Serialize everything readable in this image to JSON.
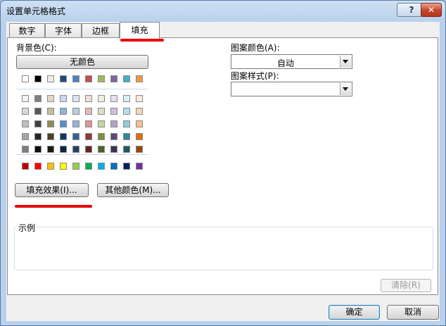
{
  "window": {
    "title": "设置单元格格式",
    "help": "?",
    "close": "✕"
  },
  "tabs": [
    {
      "label": "数字",
      "active": false
    },
    {
      "label": "字体",
      "active": false
    },
    {
      "label": "边框",
      "active": false
    },
    {
      "label": "填充",
      "active": true
    }
  ],
  "fill": {
    "background_label": "背景色(C):",
    "no_color": "无颜色",
    "theme_row": [
      "#ffffff",
      "#000000",
      "#eeece1",
      "#1f497d",
      "#4f81bd",
      "#c0504d",
      "#9bbb59",
      "#8064a2",
      "#4bacc6",
      "#f79646"
    ],
    "shade_rows": [
      [
        "#f2f2f2",
        "#7f7f7f",
        "#ddd9c3",
        "#c6d9f0",
        "#dbe5f1",
        "#f2dcdb",
        "#ebf1dd",
        "#e5e0ec",
        "#dbeef3",
        "#fdeada"
      ],
      [
        "#d8d8d8",
        "#595959",
        "#c4bd97",
        "#8db3e2",
        "#b8cce4",
        "#e5b9b7",
        "#d7e3bc",
        "#ccc1d9",
        "#b7dde8",
        "#fbd5b5"
      ],
      [
        "#bfbfbf",
        "#3f3f3f",
        "#938953",
        "#548dd4",
        "#95b3d7",
        "#d99694",
        "#c3d69b",
        "#b2a2c7",
        "#92cddc",
        "#fac08f"
      ],
      [
        "#a5a5a5",
        "#262626",
        "#494429",
        "#17365d",
        "#366092",
        "#953734",
        "#76923c",
        "#5f497a",
        "#31859b",
        "#e36c09"
      ],
      [
        "#7f7f7f",
        "#0c0c0c",
        "#1d1b10",
        "#0f243e",
        "#244061",
        "#632423",
        "#4f6128",
        "#3f3151",
        "#205867",
        "#974806"
      ]
    ],
    "standard_row": [
      "#c00000",
      "#ff0000",
      "#ffc000",
      "#ffff00",
      "#92d050",
      "#00b050",
      "#00b0f0",
      "#0070c0",
      "#002060",
      "#7030a0"
    ],
    "fill_effects": "填充效果(I)...",
    "more_colors": "其他颜色(M)...",
    "pattern_color_label": "图案颜色(A):",
    "pattern_color_value": "自动",
    "pattern_style_label": "图案样式(P):",
    "pattern_style_value": "",
    "sample_label": "示例",
    "clear": "清除(R)"
  },
  "footer": {
    "ok": "确定",
    "cancel": "取消"
  },
  "colors": {
    "annotation": "#e8000b"
  }
}
